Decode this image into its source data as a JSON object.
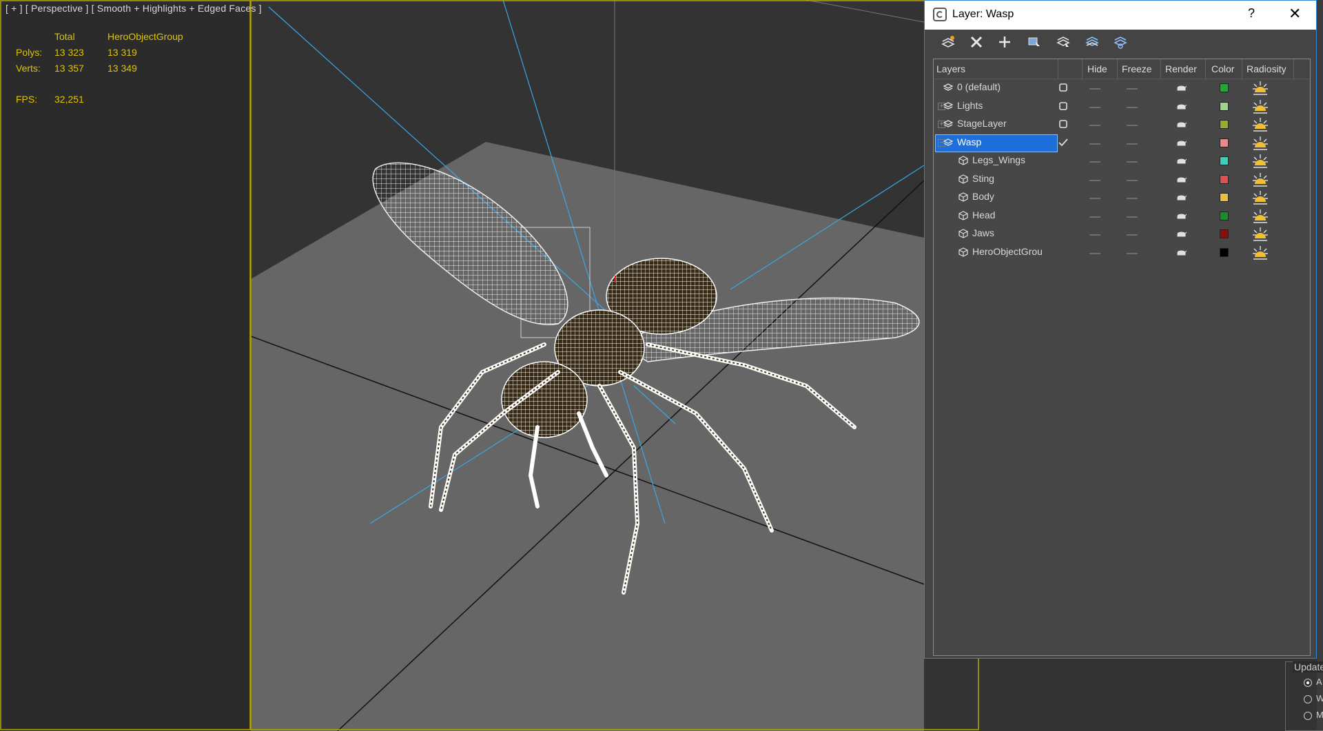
{
  "viewport": {
    "label": "[ + ] [ Perspective ] [ Smooth + Highlights + Edged Faces ]",
    "stats": {
      "col_total": "Total",
      "col_group": "HeroObjectGroup",
      "polys_label": "Polys:",
      "polys_total": "13 323",
      "polys_group": "13 319",
      "verts_label": "Verts:",
      "verts_total": "13 357",
      "verts_group": "13 349",
      "fps_label": "FPS:",
      "fps_value": "32,251"
    }
  },
  "dialog": {
    "title": "Layer: Wasp",
    "help": "?",
    "close": "✕",
    "toolbar": [
      "create-new-layer",
      "delete-layer",
      "add-selection-to-layer",
      "select-objects-in-layer",
      "highlight-selected-layer",
      "hide-all-layers",
      "freeze-all-layers"
    ],
    "columns": {
      "layers": "Layers",
      "hide": "Hide",
      "freeze": "Freeze",
      "render": "Render",
      "color": "Color",
      "radiosity": "Radiosity"
    },
    "rows": [
      {
        "name": "0 (default)",
        "type": "layer",
        "expander": "",
        "current": false,
        "color": "#22a83a"
      },
      {
        "name": "Lights",
        "type": "layer",
        "expander": "+",
        "current": false,
        "color": "#9fd28a"
      },
      {
        "name": "StageLayer",
        "type": "layer",
        "expander": "+",
        "current": false,
        "color": "#9aaa2a"
      },
      {
        "name": "Wasp",
        "type": "layer",
        "expander": "−",
        "current": true,
        "selected": true,
        "color": "#e88a8a"
      },
      {
        "name": "Legs_Wings",
        "type": "object",
        "expander": "",
        "current": false,
        "color": "#3fcfb8"
      },
      {
        "name": "Sting",
        "type": "object",
        "expander": "",
        "current": false,
        "color": "#e05050"
      },
      {
        "name": "Body",
        "type": "object",
        "expander": "",
        "current": false,
        "color": "#e8c040"
      },
      {
        "name": "Head",
        "type": "object",
        "expander": "",
        "current": false,
        "color": "#1e8a2e"
      },
      {
        "name": "Jaws",
        "type": "object",
        "expander": "",
        "current": false,
        "color": "#8a0e0e"
      },
      {
        "name": "HeroObjectGrou",
        "type": "object",
        "expander": "",
        "current": false,
        "color": "#000000"
      }
    ]
  },
  "update_group": {
    "label": "Update",
    "options": [
      "A",
      "W",
      "M"
    ]
  },
  "colors": {
    "viewport_bg": "#2b2b2b",
    "ground": "#666666",
    "selection_blue": "#1e6fd9",
    "light_lines": "#3aa7e8",
    "stats_yellow": "#e0c400"
  }
}
